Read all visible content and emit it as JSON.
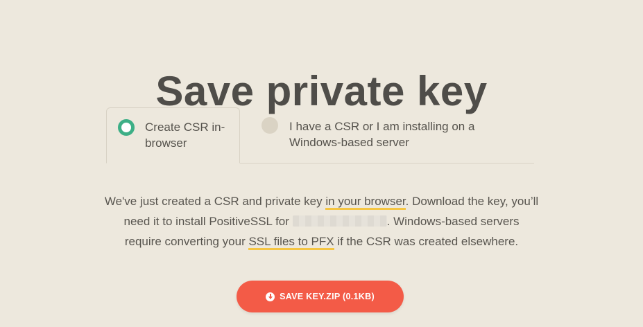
{
  "page": {
    "title": "Save private key"
  },
  "tabs": [
    {
      "label": "Create CSR in-browser",
      "selected": true
    },
    {
      "label": "I have a CSR or I am installing on a Windows-based server",
      "selected": false
    }
  ],
  "description": {
    "part1": "We've just created a CSR and private key ",
    "link1": "in your browser",
    "part2": ". Download the key, you’ll need it to install PositiveSSL for ",
    "part3": ". Windows-based servers require converting your ",
    "link2": "SSL files to PFX",
    "part4": " if the CSR was created elsewhere."
  },
  "save_button": {
    "label": "SAVE KEY.ZIP (0.1KB)",
    "icon": "download-circle-icon"
  },
  "colors": {
    "background": "#ede8dd",
    "accent_green": "#3daf86",
    "button_red": "#f35b47",
    "highlight_yellow": "#f5c542"
  }
}
